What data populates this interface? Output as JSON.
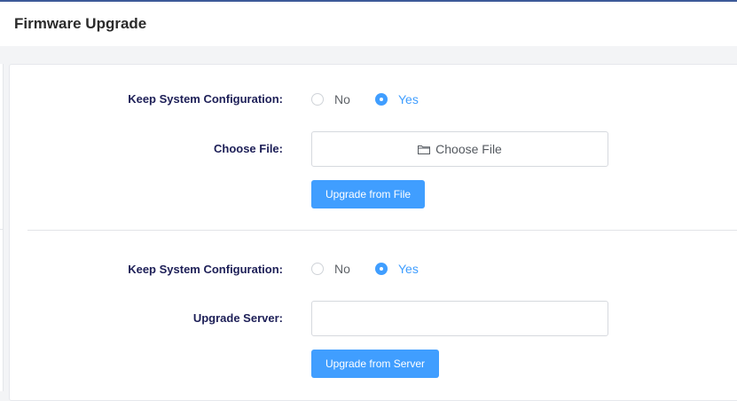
{
  "header": {
    "title": "Firmware Upgrade"
  },
  "file_section": {
    "keep_config_label": "Keep System Configuration:",
    "options": {
      "no": "No",
      "yes": "Yes"
    },
    "selected": "yes",
    "choose_file_label": "Choose File:",
    "choose_file_button": "Choose File",
    "upgrade_button": "Upgrade from File"
  },
  "server_section": {
    "keep_config_label": "Keep System Configuration:",
    "options": {
      "no": "No",
      "yes": "Yes"
    },
    "selected": "yes",
    "server_label": "Upgrade Server:",
    "server_value": "",
    "upgrade_button": "Upgrade from Server"
  },
  "colors": {
    "accent": "#409eff",
    "label": "#1d1f57",
    "top_border": "#3d5a99"
  }
}
